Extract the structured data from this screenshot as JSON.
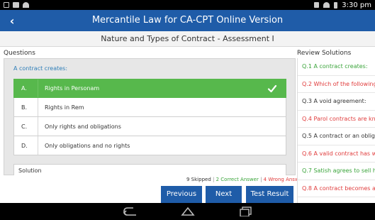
{
  "status_bar": {
    "time": "3:30 pm"
  },
  "app_bar": {
    "title": "Mercantile Law for CA-CPT Online Version",
    "back_glyph": "‹"
  },
  "sub_header": {
    "title": "Nature and Types of Contract - Assessment I"
  },
  "questions": {
    "section_label": "Questions",
    "question_text": "A contract creates:",
    "options": [
      {
        "letter": "A.",
        "text": "Rights in Personam",
        "state": "correct"
      },
      {
        "letter": "B.",
        "text": "Rights in Rem",
        "state": "normal"
      },
      {
        "letter": "C.",
        "text": "Only rights and obligations",
        "state": "normal"
      },
      {
        "letter": "D.",
        "text": "Only obligations and no rights",
        "state": "normal"
      }
    ],
    "solution_label": "Solution"
  },
  "stats": {
    "skipped": "9 Skipped",
    "separator": "|",
    "correct": "2 Correct Answer",
    "wrong": "4 Wrong Answer"
  },
  "buttons": {
    "previous": "Previous",
    "next": "Next",
    "test_result": "Test Result"
  },
  "review": {
    "section_label": "Review Solutions",
    "items": [
      {
        "text": "Q.1 A contract creates:",
        "status": "correct"
      },
      {
        "text": "Q.2 Which of the following ar",
        "status": "wrong"
      },
      {
        "text": "Q.3 A void agreement:",
        "status": "skipped"
      },
      {
        "text": "Q.4 Parol contracts are known",
        "status": "wrong"
      },
      {
        "text": "Q.5 A contract or an obligatio",
        "status": "skipped"
      },
      {
        "text": "Q.6 A valid contract has which",
        "status": "wrong"
      },
      {
        "text": "Q.7 Satish agrees to sell his h",
        "status": "correct"
      },
      {
        "text": "Q.8 A contract becomes a con",
        "status": "wrong"
      }
    ]
  },
  "colors": {
    "app_bar": "#1f5ca8",
    "correct": "#57b84c",
    "correct_text": "#3aa43a",
    "wrong_text": "#e03b3b",
    "question_text": "#2e7eb8"
  },
  "icons": {
    "status_left": [
      "notification-icon",
      "image-icon",
      "wifi-icon"
    ],
    "status_right": [
      "download-icon",
      "wifi-signal-icon",
      "battery-icon"
    ],
    "nav": [
      "back-nav-icon",
      "home-nav-icon",
      "recents-nav-icon"
    ],
    "check": "check-icon"
  }
}
